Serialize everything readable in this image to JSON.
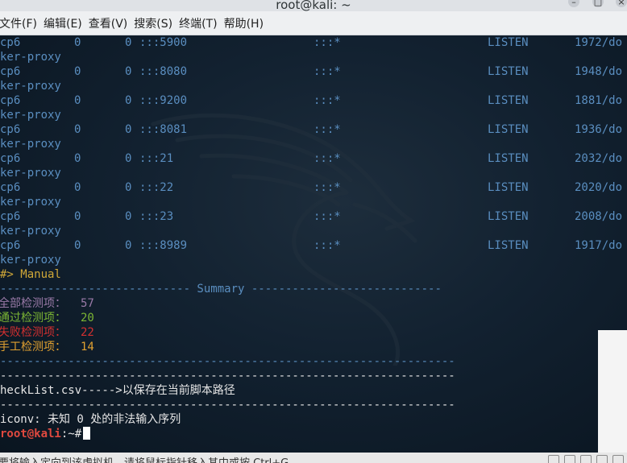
{
  "window": {
    "title": "root@kali: ~"
  },
  "menu": [
    {
      "label": "文件(F)"
    },
    {
      "label": "编辑(E)"
    },
    {
      "label": "查看(V)"
    },
    {
      "label": "搜索(S)"
    },
    {
      "label": "终端(T)"
    },
    {
      "label": "帮助(H)"
    }
  ],
  "netstat_rows": [
    {
      "proto": "cp6",
      "recv": "0",
      "send": "0",
      "local": ":::5900",
      "foreign": ":::*",
      "state": "LISTEN",
      "pid": "1972/do",
      "prog": "ker-proxy"
    },
    {
      "proto": "cp6",
      "recv": "0",
      "send": "0",
      "local": ":::8080",
      "foreign": ":::*",
      "state": "LISTEN",
      "pid": "1948/do",
      "prog": "ker-proxy"
    },
    {
      "proto": "cp6",
      "recv": "0",
      "send": "0",
      "local": ":::9200",
      "foreign": ":::*",
      "state": "LISTEN",
      "pid": "1881/do",
      "prog": "ker-proxy"
    },
    {
      "proto": "cp6",
      "recv": "0",
      "send": "0",
      "local": ":::8081",
      "foreign": ":::*",
      "state": "LISTEN",
      "pid": "1936/do",
      "prog": "ker-proxy"
    },
    {
      "proto": "cp6",
      "recv": "0",
      "send": "0",
      "local": ":::21",
      "foreign": ":::*",
      "state": "LISTEN",
      "pid": "2032/do",
      "prog": "ker-proxy"
    },
    {
      "proto": "cp6",
      "recv": "0",
      "send": "0",
      "local": ":::22",
      "foreign": ":::*",
      "state": "LISTEN",
      "pid": "2020/do",
      "prog": "ker-proxy"
    },
    {
      "proto": "cp6",
      "recv": "0",
      "send": "0",
      "local": ":::23",
      "foreign": ":::*",
      "state": "LISTEN",
      "pid": "2008/do",
      "prog": "ker-proxy"
    },
    {
      "proto": "cp6",
      "recv": "0",
      "send": "0",
      "local": ":::8989",
      "foreign": ":::*",
      "state": "LISTEN",
      "pid": "1917/do",
      "prog": "ker-proxy"
    }
  ],
  "manual_line": "#> Manual",
  "summary_line": "---------------------------- Summary ----------------------------",
  "summary": {
    "total_label": "全部检测项：",
    "total": "57",
    "pass_label": "通过检测项：",
    "pass": "20",
    "fail_label": "失败检测项：",
    "fail": "22",
    "manual_label": "手工检测项：",
    "manual": "14"
  },
  "dash_line": "-------------------------------------------------------------------",
  "csv_line": "heckList.csv----->以保存在当前脚本路径",
  "iconv_line": "iconv: 未知 0 处的非法输入序列",
  "prompt": {
    "user_host": "root@kali",
    "suffix": ":~#"
  },
  "statusbar": {
    "text": "要将输入定向到该虚拟机，请将鼠标指针移入其中或按 Ctrl+G。"
  },
  "colors": {
    "terminal_bg": "#122130",
    "listen_blue": "#5a8ec0",
    "prompt_red": "#e0493f"
  }
}
